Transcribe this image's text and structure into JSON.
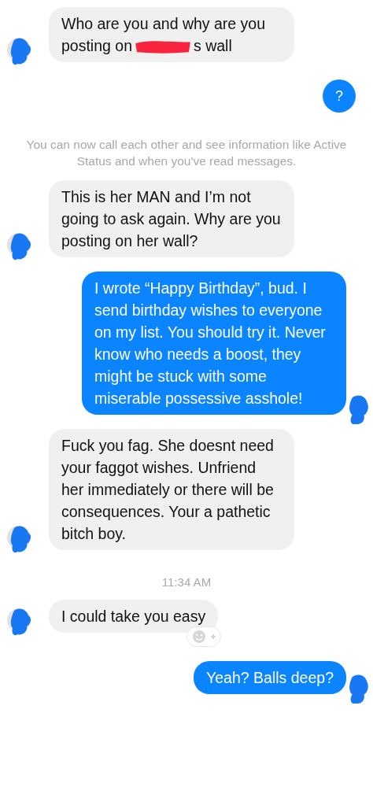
{
  "messages": [
    {
      "kind": "incoming",
      "text": "Who are you and why are you posting on",
      "text_after": "s wall",
      "redacted": true
    },
    {
      "kind": "outgoing-icon",
      "text": "?"
    },
    {
      "kind": "notice",
      "text": "You can now call each other and see information like Active Status and when you've read messages."
    },
    {
      "kind": "incoming",
      "text": "This is her MAN and I’m not going to ask again. Why are you posting on her wall?"
    },
    {
      "kind": "outgoing",
      "text": "I wrote “Happy Birthday”, bud. I send birthday wishes to everyone on my list. You should try it. Never know who needs a boost, they might be stuck with some miserable possessive asshole!"
    },
    {
      "kind": "incoming",
      "text": "Fuck you fag. She doesnt need your faggot wishes. Unfriend her immediately or there will be consequences. Your a pathetic bitch boy."
    },
    {
      "kind": "time",
      "text": "11:34 AM"
    },
    {
      "kind": "incoming",
      "text": "I could take you easy",
      "reaction_button": true
    },
    {
      "kind": "outgoing",
      "text": "Yeah? Balls deep?"
    }
  ]
}
